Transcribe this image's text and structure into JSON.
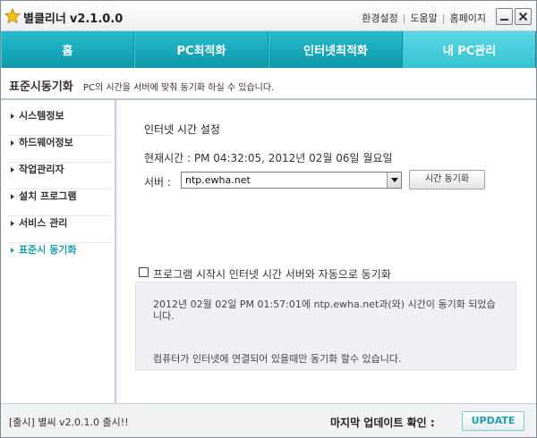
{
  "app": {
    "title": "별클리너",
    "version": "v2.1.0.0"
  },
  "toplinks": {
    "settings": "환경설정",
    "help": "도움말",
    "homepage": "홈페이지"
  },
  "tabs": [
    {
      "label": "홈"
    },
    {
      "label": "PC최적화"
    },
    {
      "label": "인터넷최적화"
    },
    {
      "label": "내 PC관리"
    }
  ],
  "active_tab": 3,
  "section": {
    "title": "표준시동기화",
    "description": "PC의 시간을 서버에 맞춰 동기화 하실 수 있습니다."
  },
  "sidebar": {
    "items": [
      {
        "label": "시스템정보"
      },
      {
        "label": "하드웨어정보"
      },
      {
        "label": "작업관리자"
      },
      {
        "label": "설치 프로그램"
      },
      {
        "label": "서비스 관리"
      },
      {
        "label": "표준시 동기화"
      }
    ],
    "active_index": 5
  },
  "content": {
    "heading": "인터넷 시간 설정",
    "current_time": "현재시간 : PM 04:32:05, 2012년 02월 06일 월요일",
    "server_label": "서버 :",
    "server_value": "ntp.ewha.net",
    "sync_button": "시간 동기화",
    "auto_sync_label": "프로그램 시작시 인터넷 시간 서버와 자동으로 동기화",
    "auto_sync_checked": false,
    "info_line1": "2012년 02월 02일 PM 01:57:01에 ntp.ewha.net과(와) 시간이 동기화 되었습니다.",
    "info_line2": "컴퓨터가 인터넷에 연결되어 있을때만 동기화 할수 있습니다."
  },
  "footer": {
    "notice": "[출시] 별씨 v2.0.1.0 출시!!",
    "update_label": "마지막 업데이트 확인 :",
    "update_button": "UPDATE"
  },
  "colors": {
    "accent": "#17a9ba",
    "tab_active": "#36c3d3",
    "sidebar_active": "#1a9fb3"
  },
  "icons": {
    "logo": "star-icon",
    "minimize": "minimize-icon",
    "close": "close-icon"
  }
}
